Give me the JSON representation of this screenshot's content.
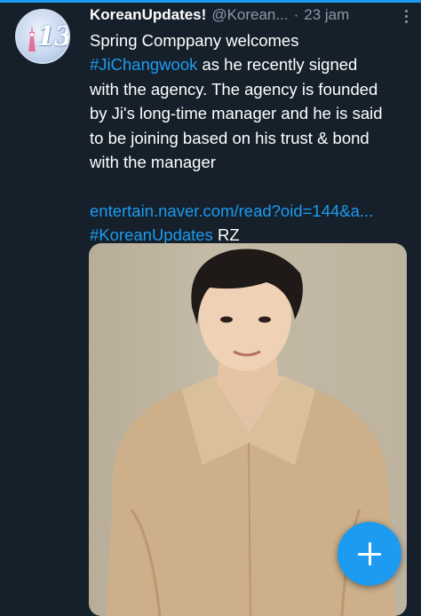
{
  "tweet": {
    "display_name": "KoreanUpdates!",
    "handle": "@Korean...",
    "separator": "·",
    "time": "23 jam",
    "text": {
      "line1": "Spring Comppany welcomes",
      "hashtag1": "#JiChangwook",
      "line2_rest": " as he recently signed",
      "line3": "with the agency. The agency is founded",
      "line4": "by Ji's long-time manager and he is said",
      "line5": "to be joining based on his trust & bond",
      "line6": "with the manager",
      "url": "entertain.naver.com/read?oid=144&a...",
      "hashtag2": "#KoreanUpdates",
      "signoff": " RZ"
    },
    "avatar": {
      "badge_text": "13"
    },
    "media": {
      "icon": "photo-image",
      "subject": "person"
    }
  },
  "compose_button": {
    "icon": "plus-icon"
  },
  "colors": {
    "background": "#15202b",
    "accent": "#1d9bf0",
    "secondary_text": "#8b98a5"
  }
}
